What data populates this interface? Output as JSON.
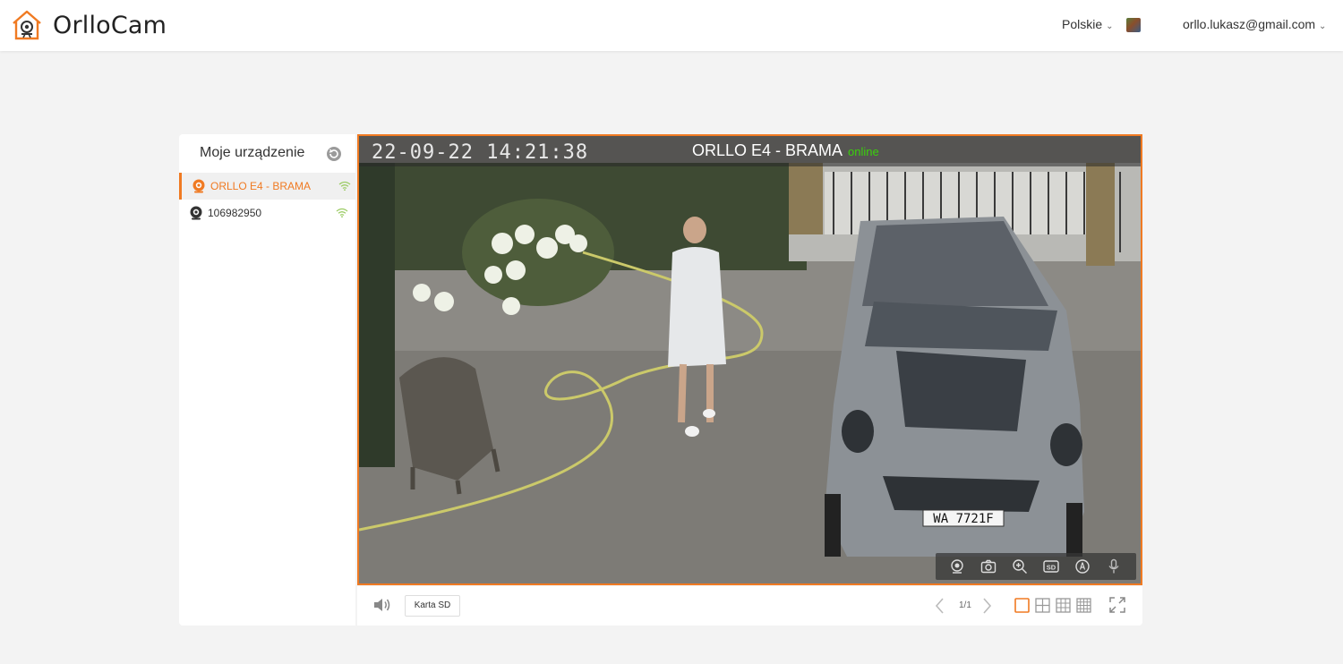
{
  "header": {
    "brand": "OrlloCam",
    "language": "Polskie",
    "user_email": "orllo.lukasz@gmail.com",
    "accent_color": "#f07a22"
  },
  "sidebar": {
    "title": "Moje urządzenie",
    "devices": [
      {
        "name": "ORLLO E4 - BRAMA",
        "active": true
      },
      {
        "name": "106982950",
        "active": false
      }
    ]
  },
  "video": {
    "timestamp": "22-09-22  14:21:38",
    "camera_name": "ORLLO E4 - BRAMA",
    "status": "online",
    "status_color": "#3ad10b",
    "plate": "WA 7721F",
    "toolbar_icons": [
      "record-icon",
      "snapshot-icon",
      "zoom-icon",
      "sd-quality-icon",
      "ptz-icon",
      "microphone-icon"
    ],
    "sd_badge": "SD"
  },
  "controls": {
    "sd_card_label": "Karta SD",
    "page_info": "1/1",
    "layouts": [
      "layout-1-icon",
      "layout-4-icon",
      "layout-9-icon",
      "layout-16-icon"
    ]
  }
}
